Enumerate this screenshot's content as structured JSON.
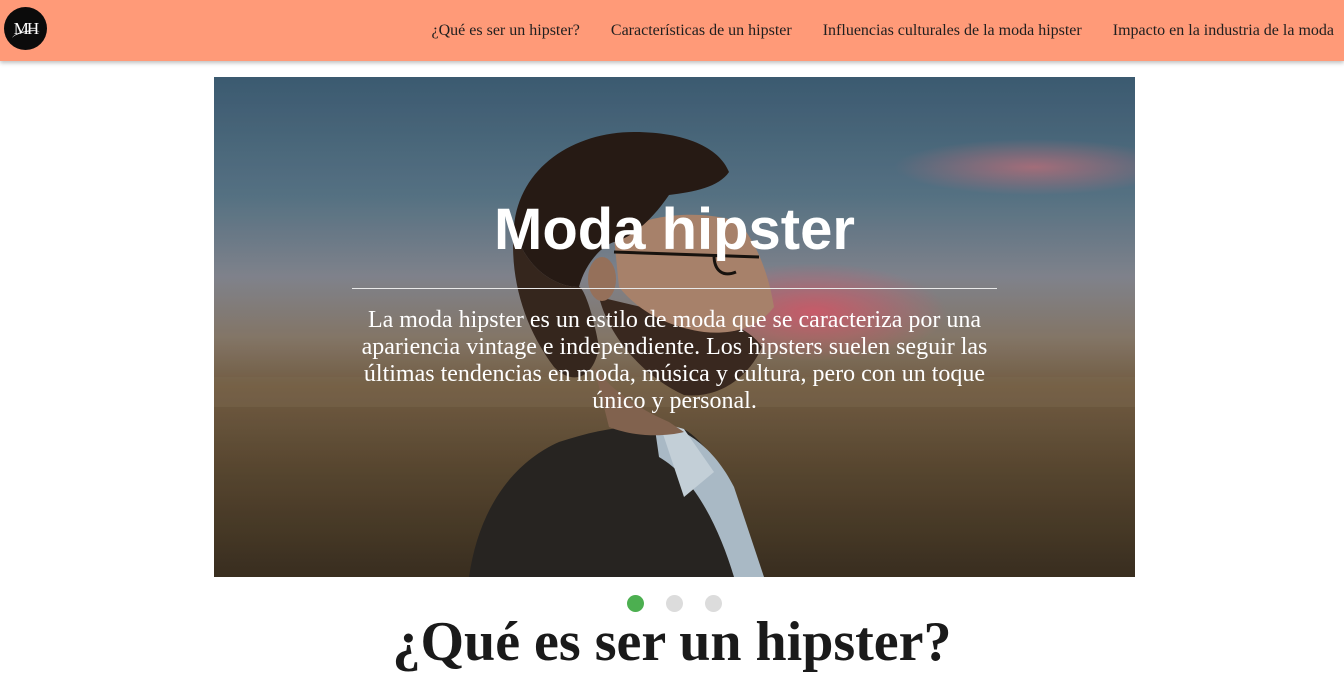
{
  "header": {
    "logo_text": "MH",
    "nav": [
      "¿Qué es ser un hipster?",
      "Características de un hipster",
      "Influencias culturales de la moda hipster",
      "Impacto en la industria de la moda"
    ],
    "background_color": "#ff9a78"
  },
  "carousel": {
    "title": "Moda hipster",
    "description": "La moda hipster es un estilo de moda que se caracteriza por una apariencia vintage e independiente. Los hipsters suelen seguir las últimas tendencias en moda, música y cultura, pero con un toque único y personal.",
    "slide_count": 3,
    "active_slide": 1,
    "active_dot_color": "#4caf50",
    "inactive_dot_color": "#dcdcdc"
  },
  "section": {
    "heading": "¿Qué es ser un hipster?"
  }
}
